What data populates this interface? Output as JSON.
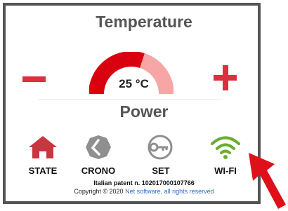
{
  "temperature": {
    "title": "Temperature",
    "value": "25 °C",
    "gauge_fraction": 0.6,
    "colors": {
      "filled": "#d9000f",
      "empty": "#f7a6a6"
    }
  },
  "controls": {
    "decrease_icon": "minus-icon",
    "increase_icon": "plus-icon",
    "color": "#d9313e"
  },
  "power": {
    "title": "Power"
  },
  "nav": [
    {
      "label": "STATE",
      "icon": "home-icon",
      "color": "#c8363f"
    },
    {
      "label": "CRONO",
      "icon": "clock-icon",
      "color": "#8f8f8f"
    },
    {
      "label": "SET",
      "icon": "key-icon",
      "color": "#8f8f8f"
    },
    {
      "label": "WI-FI",
      "icon": "wifi-icon",
      "color": "#6aad32"
    }
  ],
  "footer": {
    "patent": "Italian patent n. 102017000107766",
    "copyright_prefix": "Copyright © 2020 ",
    "copyright_link": "Net software, all rights reserved"
  },
  "annotation": {
    "arrow_icon": "pointer-arrow-icon",
    "color": "#e0101a"
  }
}
